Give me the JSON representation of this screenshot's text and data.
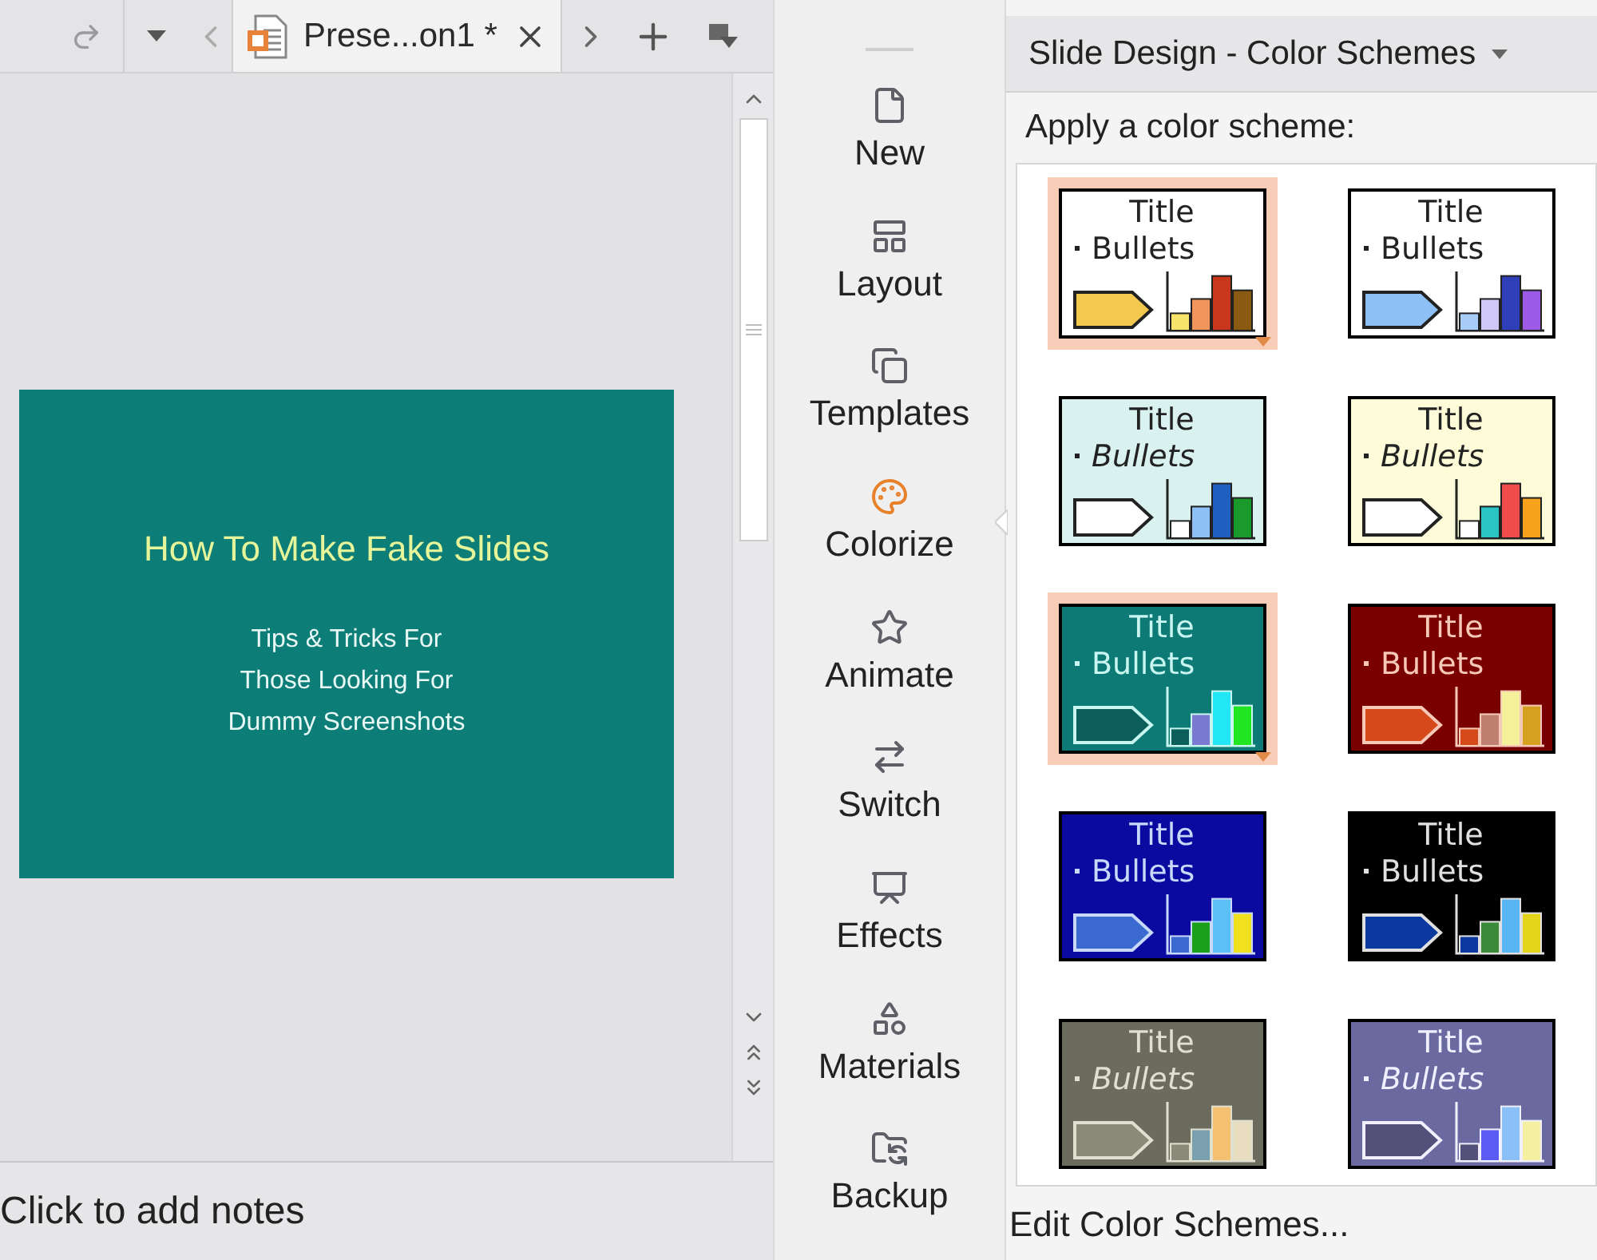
{
  "document_tab": {
    "label": "Prese...on1 *",
    "selected": true
  },
  "slide": {
    "title": "How To Make Fake Slides",
    "subtitle_lines": [
      "Tips & Tricks For",
      "Those Looking For",
      "Dummy Screenshots"
    ]
  },
  "notes": {
    "placeholder": "Click to add notes"
  },
  "sidebar": {
    "items": [
      {
        "label": "New",
        "selected": false
      },
      {
        "label": "Layout",
        "selected": false
      },
      {
        "label": "Templates",
        "selected": false
      },
      {
        "label": "Colorize",
        "selected": true
      },
      {
        "label": "Animate",
        "selected": false
      },
      {
        "label": "Switch",
        "selected": false
      },
      {
        "label": "Effects",
        "selected": false
      },
      {
        "label": "Materials",
        "selected": false
      },
      {
        "label": "Backup",
        "selected": false
      }
    ]
  },
  "panel": {
    "title": "Slide Design - Color Schemes",
    "subtitle": "Apply a color scheme:",
    "footer_link": "Edit Color Schemes..."
  },
  "color_schemes": [
    {
      "title": "Title",
      "bullets": "Bullets",
      "color": "#ffffff",
      "text": {
        "color": "#222222"
      },
      "italic": false,
      "arrow": {
        "color": "#f2c94c"
      },
      "bars": [
        {
          "color": "#f7e26b"
        },
        {
          "color": "#f0955b"
        },
        {
          "color": "#c8361b"
        },
        {
          "color": "#8b5a12"
        }
      ],
      "selected": true
    },
    {
      "title": "Title",
      "bullets": "Bullets",
      "color": "#ffffff",
      "text": {
        "color": "#222222"
      },
      "italic": false,
      "arrow": {
        "color": "#8ec0f5"
      },
      "bars": [
        {
          "color": "#a9cbf7"
        },
        {
          "color": "#cfc7f5"
        },
        {
          "color": "#2f3fb8"
        },
        {
          "color": "#9b5be8"
        }
      ],
      "selected": false
    },
    {
      "title": "Title",
      "bullets": "Bullets",
      "color": "#daf2ef",
      "text": {
        "color": "#222222"
      },
      "italic": true,
      "arrow": {
        "color": "#ffffff"
      },
      "bars": [
        {
          "color": "#ffffff"
        },
        {
          "color": "#8ec0f5"
        },
        {
          "color": "#1f5fbf"
        },
        {
          "color": "#1a9a2a"
        }
      ],
      "selected": false
    },
    {
      "title": "Title",
      "bullets": "Bullets",
      "color": "#fdfbd8",
      "text": {
        "color": "#222222"
      },
      "italic": true,
      "arrow": {
        "color": "#ffffff"
      },
      "bars": [
        {
          "color": "#ffffff"
        },
        {
          "color": "#2bc4c4"
        },
        {
          "color": "#f04b4b"
        },
        {
          "color": "#f7a21b"
        }
      ],
      "selected": false
    },
    {
      "title": "Title",
      "bullets": "Bullets",
      "color": "#0d7a75",
      "text": {
        "color": "#c8f5f0"
      },
      "italic": false,
      "arrow": {
        "color": "#0b5e5a"
      },
      "bars": [
        {
          "color": "#0b5e5a"
        },
        {
          "color": "#7a7ad0"
        },
        {
          "color": "#22e5f5"
        },
        {
          "color": "#22e522"
        }
      ],
      "selected": true
    },
    {
      "title": "Title",
      "bullets": "Bullets",
      "color": "#7a0000",
      "text": {
        "color": "#f5c8b8"
      },
      "italic": false,
      "arrow": {
        "color": "#d64a1a"
      },
      "bars": [
        {
          "color": "#d64a1a"
        },
        {
          "color": "#c08070"
        },
        {
          "color": "#f5f09b"
        },
        {
          "color": "#d6a020"
        }
      ],
      "selected": false
    },
    {
      "title": "Title",
      "bullets": "Bullets",
      "color": "#0a0aa0",
      "text": {
        "color": "#c8d8f8"
      },
      "italic": false,
      "arrow": {
        "color": "#3a6ad0"
      },
      "bars": [
        {
          "color": "#3a6ad0"
        },
        {
          "color": "#1aa01a"
        },
        {
          "color": "#5ac0f5"
        },
        {
          "color": "#f0e020"
        }
      ],
      "selected": false
    },
    {
      "title": "Title",
      "bullets": "Bullets",
      "color": "#000000",
      "text": {
        "color": "#e0e0e0"
      },
      "italic": false,
      "arrow": {
        "color": "#0a3aa0"
      },
      "bars": [
        {
          "color": "#0a3aa0"
        },
        {
          "color": "#3a8a3a"
        },
        {
          "color": "#5ab5f5"
        },
        {
          "color": "#e5d51a"
        }
      ],
      "selected": false
    },
    {
      "title": "Title",
      "bullets": "Bullets",
      "color": "#6b6b5e",
      "text": {
        "color": "#e0e0d0"
      },
      "italic": true,
      "arrow": {
        "color": "#8a8a7a"
      },
      "bars": [
        {
          "color": "#8a8a7a"
        },
        {
          "color": "#7aa0b0"
        },
        {
          "color": "#f5c070"
        },
        {
          "color": "#e8dcc0"
        }
      ],
      "selected": false
    },
    {
      "title": "Title",
      "bullets": "Bullets",
      "color": "#6a6aa0",
      "text": {
        "color": "#f0f0ff"
      },
      "italic": true,
      "arrow": {
        "color": "#55507a"
      },
      "bars": [
        {
          "color": "#55507a"
        },
        {
          "color": "#5a5af5"
        },
        {
          "color": "#8ac0f5"
        },
        {
          "color": "#f5f0a0"
        }
      ],
      "selected": false
    }
  ]
}
